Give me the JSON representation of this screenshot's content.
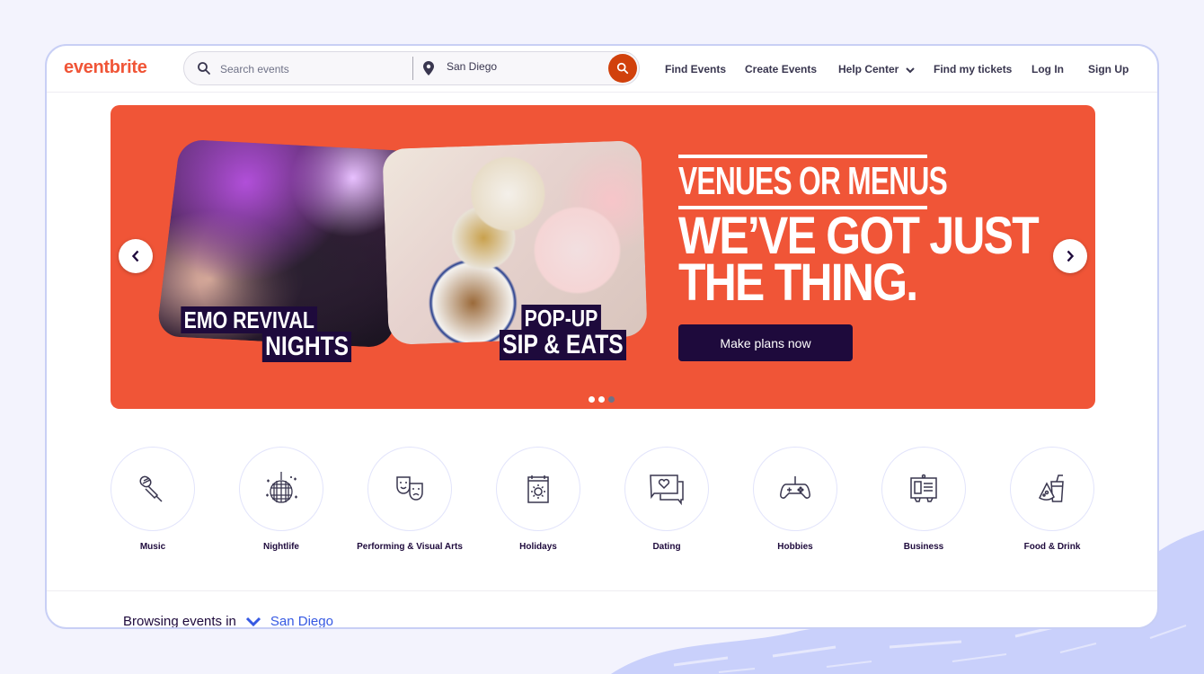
{
  "header": {
    "logo": "eventbrite",
    "search": {
      "placeholder": "Search events",
      "location": "San Diego",
      "search_icon": "search-icon",
      "location_icon": "map-pin-icon",
      "submit_icon": "search-icon"
    },
    "nav": [
      {
        "label": "Find Events"
      },
      {
        "label": "Create Events"
      },
      {
        "label": "Help Center",
        "has_dropdown": true
      },
      {
        "label": "Find my tickets"
      },
      {
        "label": "Log In"
      },
      {
        "label": "Sign Up"
      }
    ]
  },
  "hero": {
    "background_color": "#f05537",
    "cards": [
      {
        "line1": "EMO REVIVAL",
        "line2": "NIGHTS"
      },
      {
        "line1": "POP-UP",
        "line2": "SIP & EATS"
      }
    ],
    "kicker": "VENUES OR MENUS",
    "headline_line1": "WE’VE GOT JUST",
    "headline_line2": "THE THING.",
    "cta_label": "Make plans now",
    "prev_icon": "chevron-left-icon",
    "next_icon": "chevron-right-icon",
    "slides_total": 3,
    "active_slide": 3
  },
  "categories": [
    {
      "label": "Music",
      "icon": "microphone-icon"
    },
    {
      "label": "Nightlife",
      "icon": "disco-ball-icon"
    },
    {
      "label": "Performing & Visual Arts",
      "icon": "theater-masks-icon"
    },
    {
      "label": "Holidays",
      "icon": "calendar-sun-icon"
    },
    {
      "label": "Dating",
      "icon": "chat-heart-icon"
    },
    {
      "label": "Hobbies",
      "icon": "gamepad-icon"
    },
    {
      "label": "Business",
      "icon": "presentation-board-icon"
    },
    {
      "label": "Food & Drink",
      "icon": "pizza-drink-icon"
    }
  ],
  "browse": {
    "prefix": "Browsing events in",
    "city": "San Diego"
  },
  "colors": {
    "brand": "#f05537",
    "primary_dark": "#1e0a3c",
    "link_blue": "#3659e3",
    "search_button": "#d1410c"
  }
}
